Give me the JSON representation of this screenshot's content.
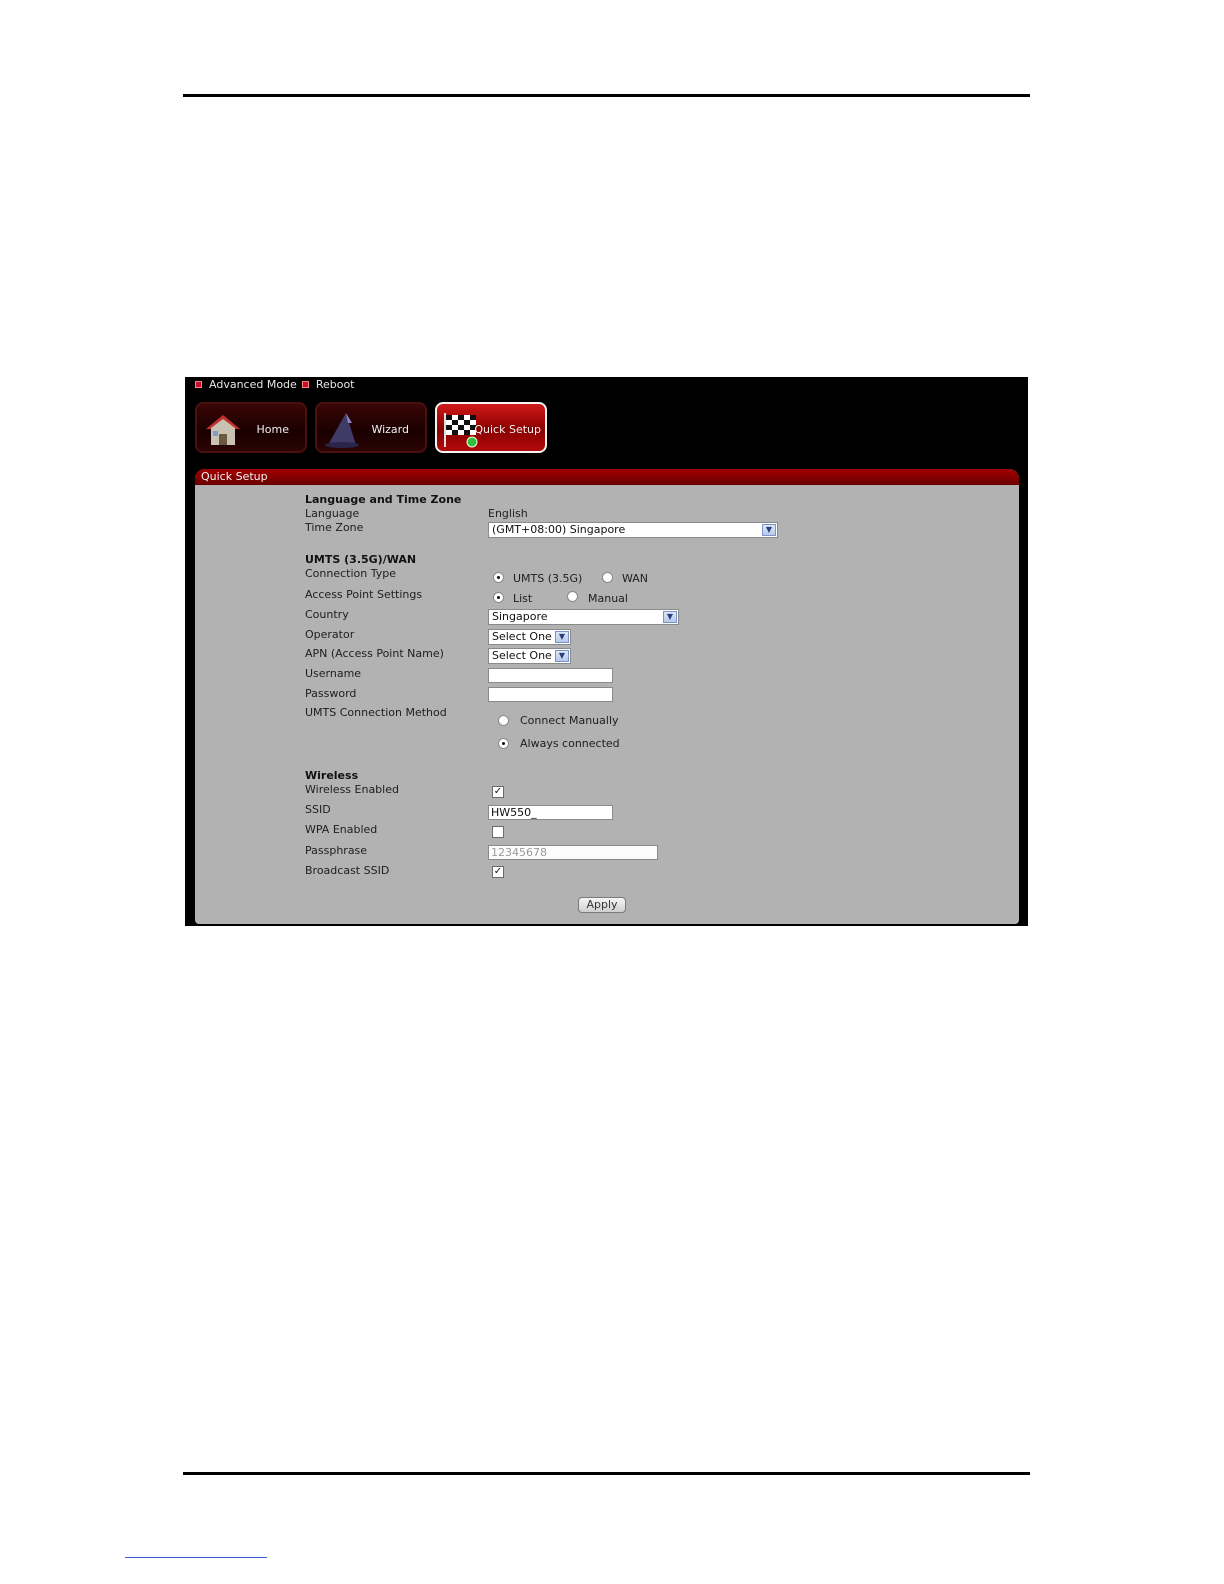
{
  "toplinks": {
    "advanced_mode": "Advanced Mode",
    "reboot": "Reboot"
  },
  "nav": {
    "home": "Home",
    "wizard": "Wizard",
    "quick_setup": "Quick Setup"
  },
  "panel": {
    "title": "Quick Setup"
  },
  "lang_tz": {
    "heading": "Language and Time Zone",
    "language_label": "Language",
    "language_value": "English",
    "timezone_label": "Time Zone",
    "timezone_value": "(GMT+08:00) Singapore"
  },
  "umts": {
    "heading": "UMTS (3.5G)/WAN",
    "connection_type_label": "Connection Type",
    "connection_options": [
      "UMTS (3.5G)",
      "WAN"
    ],
    "connection_selected": "UMTS (3.5G)",
    "ap_settings_label": "Access Point Settings",
    "ap_options": [
      "List",
      "Manual"
    ],
    "ap_selected": "List",
    "country_label": "Country",
    "country_value": "Singapore",
    "operator_label": "Operator",
    "operator_value": "Select One",
    "apn_label": "APN (Access Point Name)",
    "apn_value": "Select One",
    "username_label": "Username",
    "username_value": "",
    "password_label": "Password",
    "password_value": "",
    "method_label": "UMTS Connection Method",
    "method_options": [
      "Connect Manually",
      "Always connected"
    ],
    "method_selected": "Always connected"
  },
  "wireless": {
    "heading": "Wireless",
    "enabled_label": "Wireless Enabled",
    "enabled": true,
    "ssid_label": "SSID",
    "ssid_value": "HW550_",
    "wpa_label": "WPA Enabled",
    "wpa": false,
    "passphrase_label": "Passphrase",
    "passphrase_value": "12345678",
    "broadcast_label": "Broadcast SSID",
    "broadcast": true
  },
  "apply_label": "Apply",
  "colors": {
    "accent_red": "#a30000",
    "panel_gray": "#b2b2b2",
    "background": "#000000"
  },
  "icons": [
    "house-icon",
    "wizard-hat-icon",
    "checkered-flag-icon"
  ]
}
